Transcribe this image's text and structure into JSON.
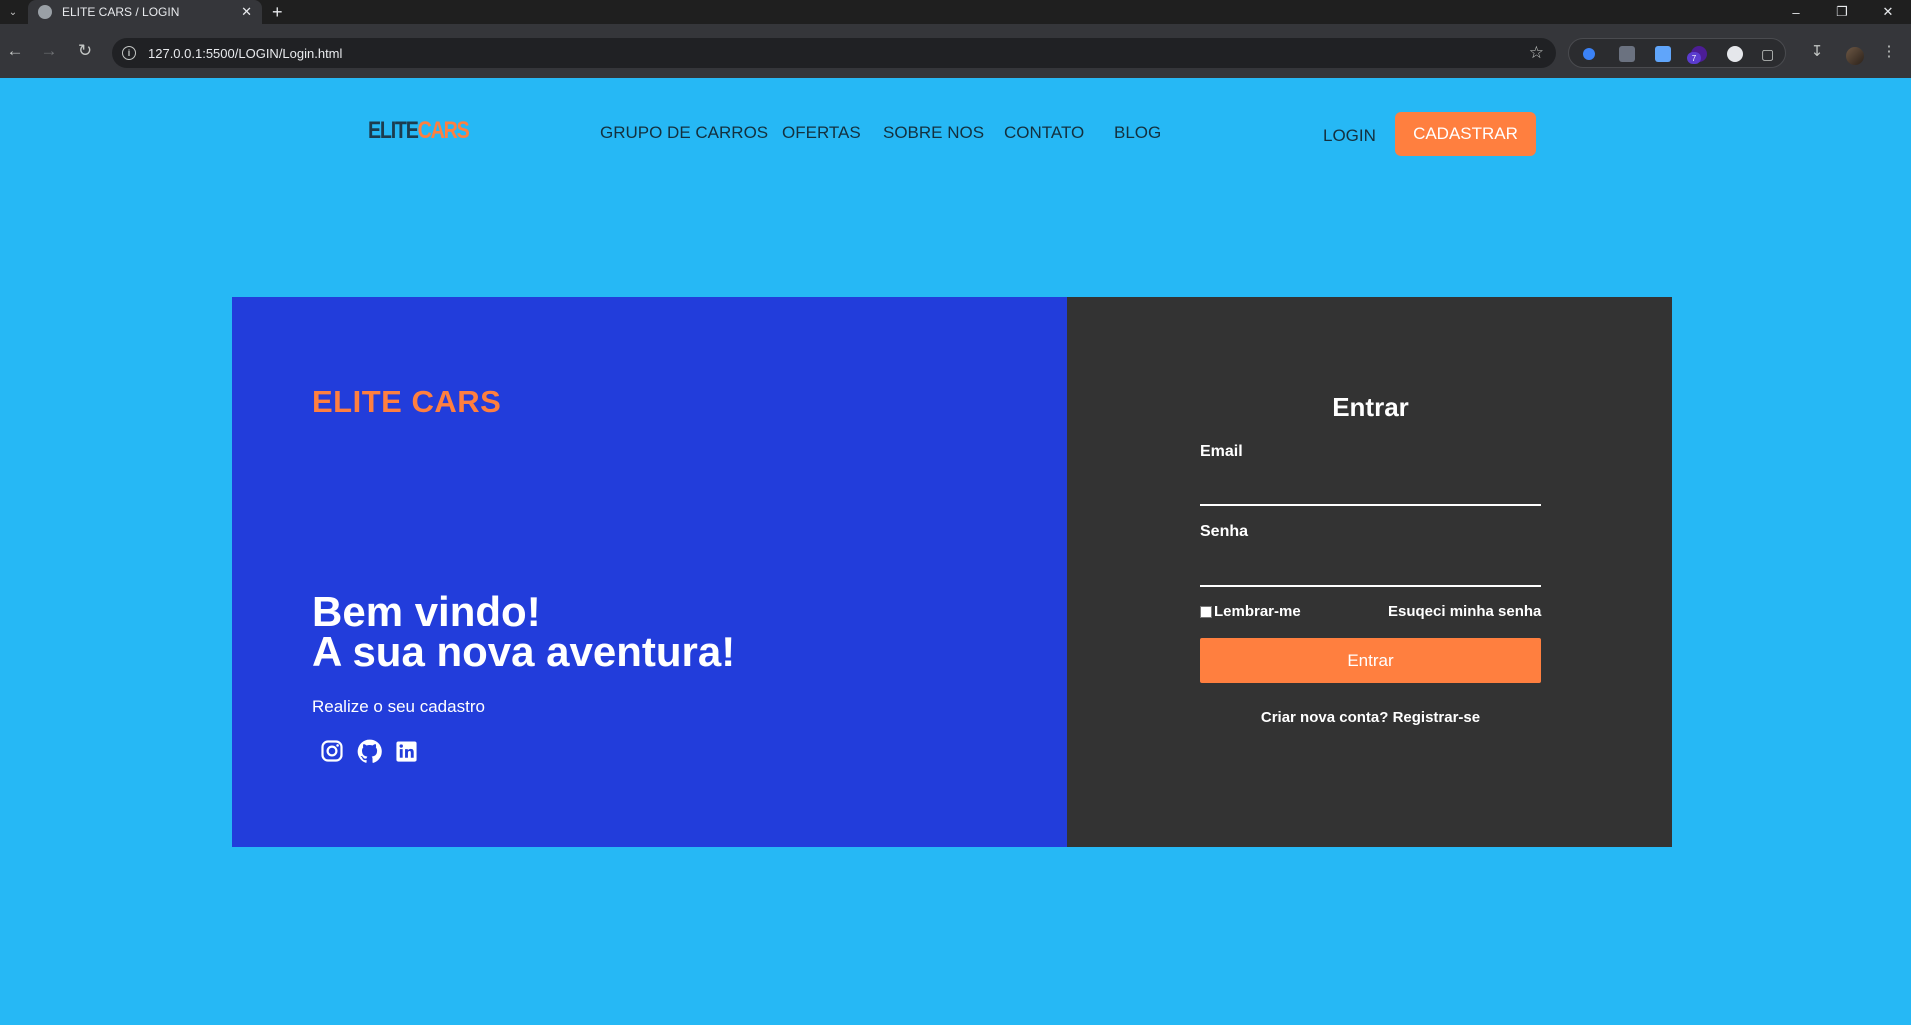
{
  "browser": {
    "tab_title": "ELITE CARS / LOGIN",
    "url": "127.0.0.1:5500/LOGIN/Login.html",
    "extension_badge": "7",
    "icons": [
      "tab-list-icon",
      "globe-icon",
      "close-icon",
      "plus-icon",
      "minimize-icon",
      "restore-icon",
      "back-icon",
      "forward-icon",
      "reload-icon",
      "info-icon",
      "star-icon",
      "puzzle-icon",
      "download-icon",
      "kebab-icon"
    ]
  },
  "header": {
    "logo_part1": "ELITE",
    "logo_part2": "CARS",
    "nav": [
      "GRUPO DE CARROS",
      "OFERTAS",
      "SOBRE NOS",
      "CONTATO",
      "BLOG"
    ],
    "login": "LOGIN",
    "signup": "CADASTRAR"
  },
  "hero": {
    "brand": "ELITE CARS",
    "welcome_line1": "Bem vindo!",
    "welcome_line2": "A sua nova aventura!",
    "subtitle": "Realize o seu cadastro",
    "social_icons": [
      "instagram-icon",
      "github-icon",
      "linkedin-icon"
    ]
  },
  "form": {
    "title": "Entrar",
    "email_label": "Email",
    "email_value": "",
    "password_label": "Senha",
    "password_value": "",
    "remember": "Lembrar-me",
    "forgot": "Esuqeci minha senha",
    "submit": "Entrar",
    "register": "Criar nova conta? Registrar-se"
  },
  "colors": {
    "page_bg": "#26b8f5",
    "accent": "#ff7f3f",
    "card_left": "#223ddb",
    "card_right": "#333333"
  }
}
